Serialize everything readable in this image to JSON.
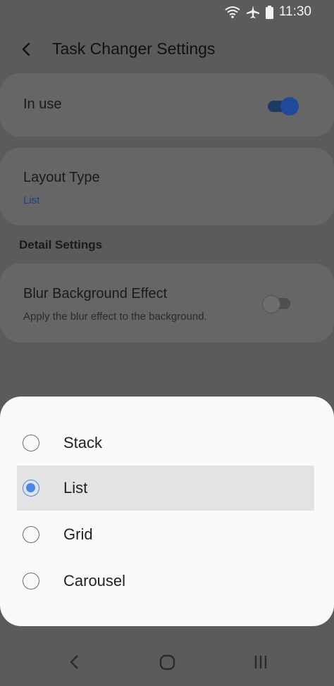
{
  "status": {
    "time": "11:30"
  },
  "header": {
    "title": "Task Changer Settings"
  },
  "in_use": {
    "label": "In use",
    "enabled": true
  },
  "layout": {
    "label": "Layout Type",
    "value": "List"
  },
  "detail_section": {
    "label": "Detail Settings"
  },
  "blur": {
    "label": "Blur Background Effect",
    "description": "Apply the blur effect to the background.",
    "enabled": false
  },
  "sheet": {
    "options": [
      {
        "label": "Stack",
        "selected": false
      },
      {
        "label": "List",
        "selected": true
      },
      {
        "label": "Grid",
        "selected": false
      },
      {
        "label": "Carousel",
        "selected": false
      }
    ]
  },
  "colors": {
    "accent": "#4a86e8",
    "scrim": "#5b5b5b",
    "sheet": "#fafafa"
  }
}
